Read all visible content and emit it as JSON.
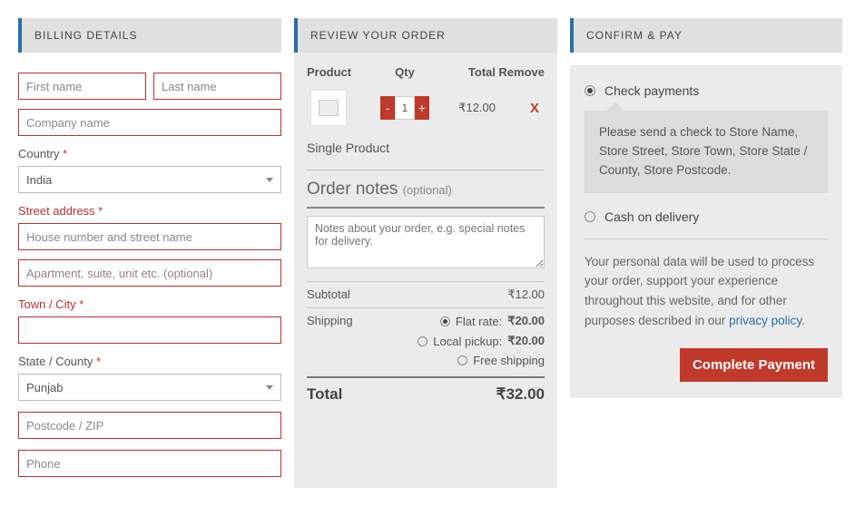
{
  "billing": {
    "header": "BILLING DETAILS",
    "first_name_ph": "First name",
    "last_name_ph": "Last name",
    "company_ph": "Company name",
    "country_label": "Country",
    "country_value": "India",
    "street_label": "Street address",
    "street1_ph": "House number and street name",
    "street2_ph": "Apartment, suite, unit etc. (optional)",
    "city_label": "Town / City",
    "state_label": "State / County",
    "state_value": "Punjab",
    "postcode_ph": "Postcode / ZIP",
    "phone_ph": "Phone",
    "asterisk": "*"
  },
  "review": {
    "header": "REVIEW YOUR ORDER",
    "th_product": "Product",
    "th_qty": "Qty",
    "th_total": "Total",
    "th_remove": "Remove",
    "items": [
      {
        "name": "Single Product",
        "qty": "1",
        "line_total": "₹12.00",
        "remove": "X"
      }
    ],
    "notes_title": "Order notes",
    "notes_optional": "(optional)",
    "notes_ph": "Notes about your order, e.g. special notes for delivery.",
    "subtotal_label": "Subtotal",
    "subtotal_value": "₹12.00",
    "shipping_label": "Shipping",
    "shipping_options": [
      {
        "label": "Flat rate:",
        "price": "₹20.00",
        "selected": true
      },
      {
        "label": "Local pickup:",
        "price": "₹20.00",
        "selected": false
      },
      {
        "label": "Free shipping",
        "price": "",
        "selected": false
      }
    ],
    "total_label": "Total",
    "total_value": "₹32.00"
  },
  "confirm": {
    "header": "CONFIRM & PAY",
    "methods": [
      {
        "label": "Check payments",
        "selected": true,
        "desc": "Please send a check to Store Name, Store Street, Store Town, Store State / County, Store Postcode."
      },
      {
        "label": "Cash on delivery",
        "selected": false
      }
    ],
    "privacy_text": "Your personal data will be used to process your order, support your experience throughout this website, and for other purposes described in our ",
    "privacy_link": "privacy policy",
    "button": "Complete Payment"
  }
}
